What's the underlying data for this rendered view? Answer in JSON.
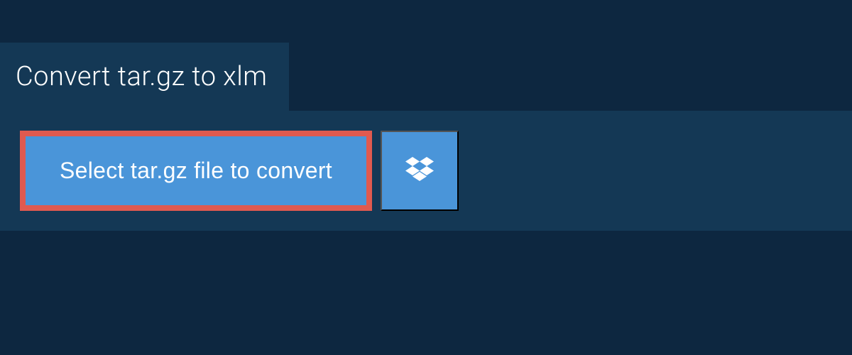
{
  "header": {
    "title": "Convert tar.gz to xlm"
  },
  "actions": {
    "select_file_label": "Select tar.gz file to convert",
    "dropbox_icon": "dropbox"
  },
  "colors": {
    "page_bg": "#0d2740",
    "panel_bg": "#143855",
    "button_bg": "#4a95d9",
    "button_border": "#e05a4f",
    "text": "#ffffff"
  }
}
